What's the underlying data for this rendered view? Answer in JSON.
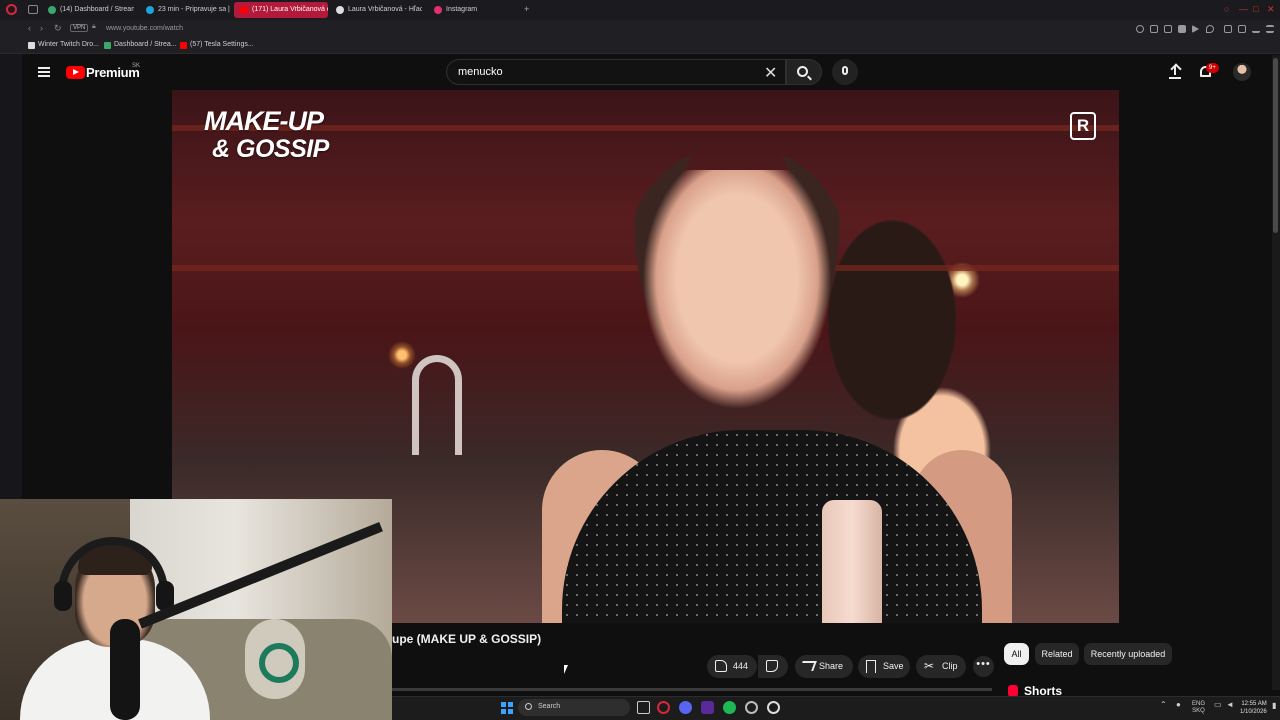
{
  "browser": {
    "tabs": [
      {
        "label": "(14) Dashboard / Streami",
        "active": false,
        "favicon_color": "#3aa86b"
      },
      {
        "label": "23 min - Pripravuje sa | W",
        "active": false,
        "favicon_color": "#1fa3d9"
      },
      {
        "label": "(171) Laura Vrbičanová o",
        "active": true,
        "favicon_color": "#ff0000"
      },
      {
        "label": "Laura Vrbičanová - Hľadať",
        "active": false,
        "favicon_color": "#dddddd"
      },
      {
        "label": "Instagram",
        "active": false,
        "favicon_color": "#e1306c"
      }
    ],
    "new_tab": "+",
    "url": "www.youtube.com/watch",
    "vpn_label": "VPN",
    "bookmarks": [
      {
        "label": "Winter Twitch Dro...",
        "favicon_color": "#dddddd"
      },
      {
        "label": "Dashboard / Strea...",
        "favicon_color": "#3aa86b"
      },
      {
        "label": "(57) Tesla Settings...",
        "favicon_color": "#ff0000"
      }
    ]
  },
  "youtube": {
    "brand": "Premium",
    "region": "SK",
    "search": {
      "value": "menucko",
      "clear_icon": "close-icon",
      "search_icon": "search-icon"
    },
    "notifications_badge": "9+",
    "accent": "#ff0000"
  },
  "video": {
    "overlay_line1": "MAKE-UP",
    "overlay_line2": "& GOSSIP",
    "channel_badge": "R",
    "title_visible": "upe (MAKE UP & GOSSIP)",
    "likes": "444",
    "actions": {
      "share": "Share",
      "save": "Save",
      "clip": "Clip",
      "more": "•••"
    }
  },
  "related": {
    "chips": [
      {
        "label": "All",
        "active": true
      },
      {
        "label": "Related",
        "active": false
      },
      {
        "label": "Recently uploaded",
        "active": false
      }
    ],
    "shorts_label": "Shorts"
  },
  "taskbar": {
    "search_label": "Search",
    "tray_lang": "ENG",
    "tray_layout": "SKQ",
    "time": "12:55 AM",
    "date": "1/10/2026"
  }
}
